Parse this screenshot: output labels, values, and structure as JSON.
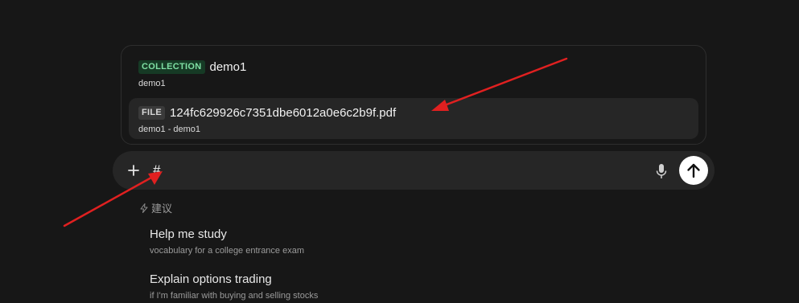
{
  "mention_popup": {
    "items": [
      {
        "tag": "COLLECTION",
        "title": "demo1",
        "subtitle": "demo1",
        "tag_color": "#7fe0a4"
      },
      {
        "tag": "FILE",
        "title": "124fc629926c7351dbe6012a0e6c2b9f.pdf",
        "subtitle": "demo1 - demo1",
        "tag_color": "#d8d8d8"
      }
    ]
  },
  "input_bar": {
    "value": "#",
    "icons": {
      "plus": "plus-icon",
      "mic": "microphone-icon",
      "send": "arrow-up-icon"
    }
  },
  "suggestions": {
    "header": "建议",
    "header_icon": "lightning-icon",
    "items": [
      {
        "title": "Help me study",
        "subtitle": "vocabulary for a college entrance exam"
      },
      {
        "title": "Explain options trading",
        "subtitle": "if I'm familiar with buying and selling stocks"
      }
    ]
  },
  "colors": {
    "background": "#171717",
    "input_background": "#262626",
    "annotation_arrow": "#e02020"
  }
}
